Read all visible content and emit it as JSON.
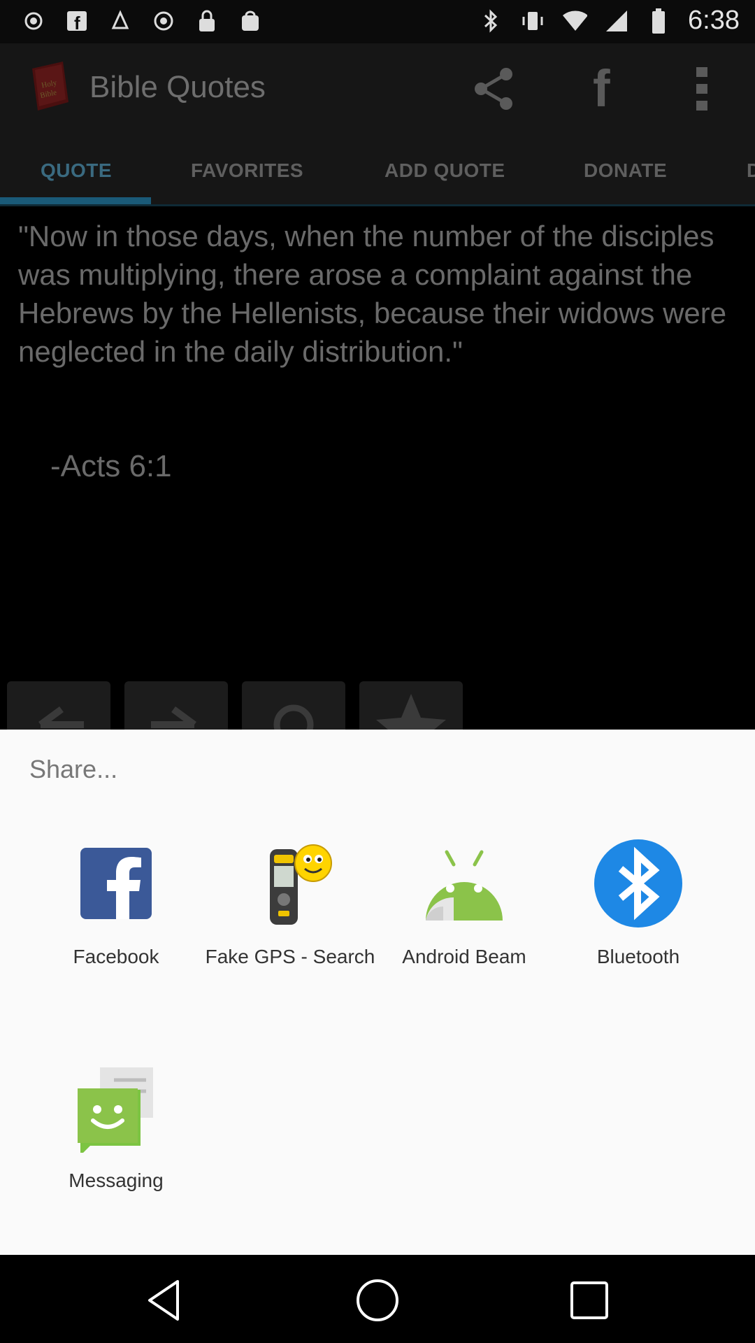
{
  "status_bar": {
    "time": "6:38",
    "icons_left": [
      "notification-dot-icon",
      "facebook-icon",
      "fake-gps-icon",
      "record-icon",
      "lock-icon",
      "bag-icon"
    ],
    "icons_right": [
      "bluetooth-icon",
      "vibrate-icon",
      "wifi-icon",
      "signal-icon",
      "battery-icon"
    ]
  },
  "app": {
    "title": "Bible Quotes",
    "tabs": [
      {
        "label": "QUOTE",
        "active": true
      },
      {
        "label": "FAVORITES",
        "active": false
      },
      {
        "label": "ADD QUOTE",
        "active": false
      },
      {
        "label": "DONATE",
        "active": false
      },
      {
        "label": "D",
        "active": false
      }
    ],
    "quote_text": "\"Now in those days, when the number of the disciples was multiplying, there arose a complaint against the Hebrews by the Hellenists, because their widows were neglected in the daily distribution.\"",
    "reference": "-Acts 6:1",
    "bottom_buttons": [
      "arrow-left-icon",
      "arrow-right-icon",
      "search-icon",
      "star-icon"
    ]
  },
  "share_sheet": {
    "title": "Share...",
    "items": [
      {
        "label": "Facebook",
        "icon": "facebook-icon"
      },
      {
        "label": "Fake GPS - Search",
        "icon": "fake-gps-icon"
      },
      {
        "label": "Android Beam",
        "icon": "android-beam-icon"
      },
      {
        "label": "Bluetooth",
        "icon": "bluetooth-icon"
      },
      {
        "label": "Messaging",
        "icon": "messaging-icon"
      }
    ]
  },
  "nav_bar": [
    "back-icon",
    "home-icon",
    "recents-icon"
  ],
  "colors": {
    "accent": "#1a5a78",
    "facebook": "#3b5998",
    "android": "#8bc34a",
    "bluetooth": "#1e88e5",
    "sheet_bg": "#fafafa"
  }
}
